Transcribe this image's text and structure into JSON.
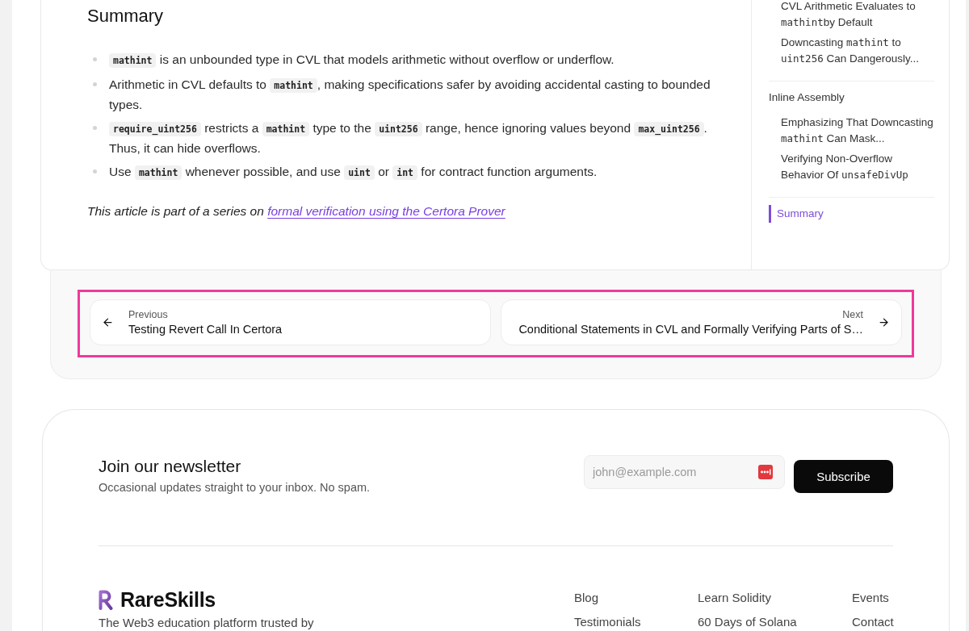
{
  "article": {
    "heading": "Summary",
    "bullets": [
      {
        "segments": [
          {
            "kind": "code",
            "text": "mathint"
          },
          {
            "kind": "text",
            "text": " is an unbounded type in CVL that models arithmetic without overflow or underflow."
          }
        ]
      },
      {
        "segments": [
          {
            "kind": "text",
            "text": "Arithmetic in CVL defaults to "
          },
          {
            "kind": "code",
            "text": "mathint"
          },
          {
            "kind": "text",
            "text": ", making specifications safer by avoiding accidental casting to bounded types."
          }
        ]
      },
      {
        "segments": [
          {
            "kind": "code",
            "text": "require_uint256"
          },
          {
            "kind": "text",
            "text": " restricts a "
          },
          {
            "kind": "code",
            "text": "mathint"
          },
          {
            "kind": "text",
            "text": " type to the "
          },
          {
            "kind": "code",
            "text": "uint256"
          },
          {
            "kind": "text",
            "text": " range, hence ignoring values beyond "
          },
          {
            "kind": "code",
            "text": "max_uint256"
          },
          {
            "kind": "text",
            "text": ". Thus, it can hide overflows."
          }
        ]
      },
      {
        "segments": [
          {
            "kind": "text",
            "text": "Use "
          },
          {
            "kind": "code",
            "text": "mathint"
          },
          {
            "kind": "text",
            "text": " whenever possible, and use "
          },
          {
            "kind": "code",
            "text": "uint"
          },
          {
            "kind": "text",
            "text": " or "
          },
          {
            "kind": "code",
            "text": "int"
          },
          {
            "kind": "text",
            "text": " for contract function arguments."
          }
        ]
      }
    ],
    "note": {
      "text": "This article is part of a series on ",
      "link": "formal verification using the Certora Prover"
    }
  },
  "toc": {
    "sections": [
      {
        "children": [
          {
            "segments": [
              {
                "kind": "text",
                "text": "CVL Arithmetic Evaluates to "
              },
              {
                "kind": "code",
                "text": "mathint"
              },
              {
                "kind": "text",
                "text": "by Default"
              }
            ],
            "selected": false
          },
          {
            "segments": [
              {
                "kind": "text",
                "text": "Downcasting "
              },
              {
                "kind": "code",
                "text": "mathint"
              },
              {
                "kind": "text",
                "text": " to "
              },
              {
                "kind": "code",
                "text": "uint256"
              },
              {
                "kind": "text",
                "text": " Can Dangerously..."
              }
            ],
            "selected": false
          }
        ]
      },
      {
        "title": "Inline Assembly",
        "selected": false,
        "children": [
          {
            "segments": [
              {
                "kind": "text",
                "text": "Emphasizing That Downcasting "
              },
              {
                "kind": "code",
                "text": "mathint"
              },
              {
                "kind": "text",
                "text": " Can Mask..."
              }
            ],
            "selected": false
          },
          {
            "segments": [
              {
                "kind": "text",
                "text": "Verifying Non-Overflow Behavior Of "
              },
              {
                "kind": "code",
                "text": "unsafeDivUp"
              }
            ],
            "selected": false
          }
        ]
      },
      {
        "title": "Summary",
        "selected": true
      }
    ]
  },
  "pagination": {
    "highlighted": true,
    "previous": {
      "label": "Previous",
      "title": "Testing Revert Call In Certora"
    },
    "next": {
      "label": "Next",
      "title": "Conditional Statements in CVL and Formally Verifying Parts of S…"
    }
  },
  "newsletter": {
    "title": "Join our newsletter",
    "subtitle": "Occasional updates straight to your inbox. No spam.",
    "email": {
      "placeholder": "john@example.com"
    },
    "button": "Subscribe"
  },
  "footer": {
    "brand": "RareSkills",
    "tagline": "The Web3 education platform trusted by",
    "link_columns": [
      [
        "Blog",
        "Testimonials"
      ],
      [
        "Learn Solidity",
        "60 Days of Solana"
      ],
      [
        "Events",
        "Contact"
      ]
    ]
  }
}
